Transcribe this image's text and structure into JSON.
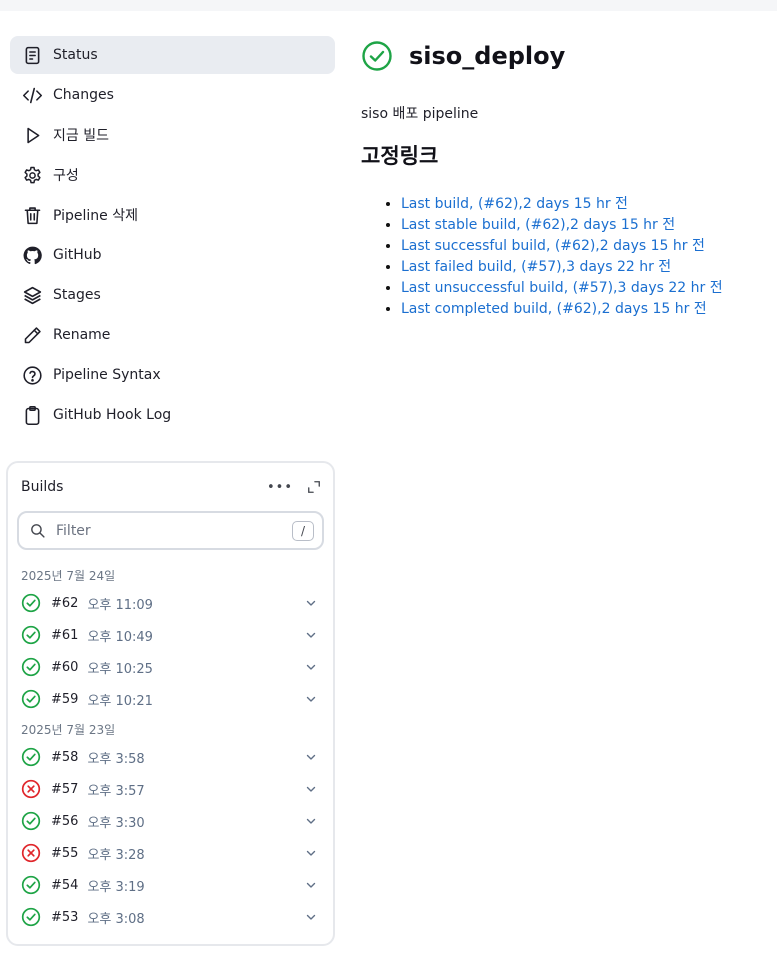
{
  "nav": {
    "items": [
      {
        "label": "Status",
        "icon": "status-icon"
      },
      {
        "label": "Changes",
        "icon": "code-icon"
      },
      {
        "label": "지금 빌드",
        "icon": "play-icon"
      },
      {
        "label": "구성",
        "icon": "gear-icon"
      },
      {
        "label": "Pipeline 삭제",
        "icon": "trash-icon"
      },
      {
        "label": "GitHub",
        "icon": "github-icon"
      },
      {
        "label": "Stages",
        "icon": "layers-icon"
      },
      {
        "label": "Rename",
        "icon": "pencil-icon"
      },
      {
        "label": "Pipeline Syntax",
        "icon": "help-circle-icon"
      },
      {
        "label": "GitHub Hook Log",
        "icon": "clipboard-icon"
      }
    ]
  },
  "builds": {
    "title": "Builds",
    "filter_placeholder": "Filter",
    "filter_shortcut": "/",
    "groups": [
      {
        "date": "2025년 7월 24일",
        "items": [
          {
            "number": "#62",
            "time": "오후 11:09",
            "status": "success"
          },
          {
            "number": "#61",
            "time": "오후 10:49",
            "status": "success"
          },
          {
            "number": "#60",
            "time": "오후 10:25",
            "status": "success"
          },
          {
            "number": "#59",
            "time": "오후 10:21",
            "status": "success"
          }
        ]
      },
      {
        "date": "2025년 7월 23일",
        "items": [
          {
            "number": "#58",
            "time": "오후 3:58",
            "status": "success"
          },
          {
            "number": "#57",
            "time": "오후 3:57",
            "status": "failed"
          },
          {
            "number": "#56",
            "time": "오후 3:30",
            "status": "success"
          },
          {
            "number": "#55",
            "time": "오후 3:28",
            "status": "failed"
          },
          {
            "number": "#54",
            "time": "오후 3:19",
            "status": "success"
          },
          {
            "number": "#53",
            "time": "오후 3:08",
            "status": "success"
          }
        ]
      }
    ]
  },
  "main": {
    "title": "siso_deploy",
    "status": "success",
    "description": "siso 배포 pipeline",
    "permalinks_heading": "고정링크",
    "permalinks": [
      "Last build, (#62),2 days 15 hr 전",
      "Last stable build, (#62),2 days 15 hr 전",
      "Last successful build, (#62),2 days 15 hr 전",
      "Last failed build, (#57),3 days 22 hr 전",
      "Last unsuccessful build, (#57),3 days 22 hr 전",
      "Last completed build, (#62),2 days 15 hr 전"
    ]
  },
  "colors": {
    "success": "#1ea446",
    "failed": "#e0262b",
    "link": "#1b6fd0"
  }
}
